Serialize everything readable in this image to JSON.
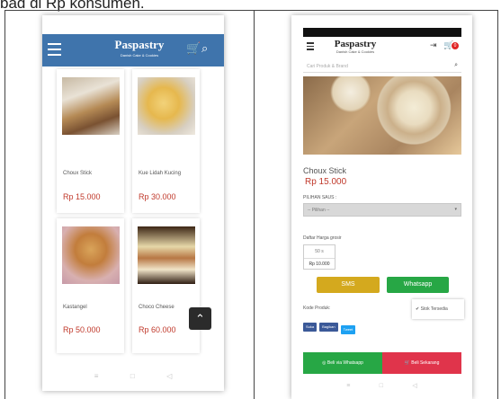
{
  "caption": "bad di Rp konsumen.",
  "left_phone": {
    "header": {
      "brand": "Paspastry",
      "tagline": "Danish Cake & Cookies",
      "menu_icon": "hamburger-icon",
      "cart_icon": "cart-icon",
      "search_icon": "search-icon"
    },
    "products": [
      {
        "name": "Choux Stick",
        "price": "Rp 15.000"
      },
      {
        "name": "Kue Lidah Kucing",
        "price": "Rp 30.000"
      },
      {
        "name": "Kastangel",
        "price": "Rp 50.000"
      },
      {
        "name": "Choco Cheese",
        "price": "Rp 60.000"
      }
    ],
    "scroll_top_glyph": "⌃",
    "nav": {
      "menu": "≡",
      "home": "□",
      "back": "◁"
    }
  },
  "right_phone": {
    "header": {
      "brand": "Paspastry",
      "tagline": "Danish Cake & Cookies",
      "badge": "0",
      "login_icon": "login-icon",
      "cart_icon": "cart-icon"
    },
    "search": {
      "placeholder": "Cari Produk & Brand"
    },
    "product": {
      "name": "Choux Stick",
      "price": "Rp 15.000",
      "option_label": "PILIHAN SAUS :",
      "option_value": "-- Pilihan --",
      "wholesale_label": "Daftar Harga grosir",
      "wholesale_qty": "50 s",
      "wholesale_price": "Rp 10.000",
      "code_label": "Kode Produk:",
      "stock": "Stok Tersedia"
    },
    "buttons": {
      "sms": "SMS",
      "whatsapp": "Whatsapp",
      "buy_wa": "Beli via Whatsapp",
      "buy_now": "Beli Sekarang"
    },
    "share": {
      "like": "Suka",
      "share": "Bagikan",
      "tweet": "Tweet"
    },
    "nav": {
      "menu": "≡",
      "home": "□",
      "back": "◁"
    }
  },
  "colors": {
    "header_blue": "#3f74ac",
    "price_red": "#c0392b",
    "sms_yellow": "#d4a91e",
    "wa_green": "#27a745",
    "buy_red": "#e0344b"
  }
}
